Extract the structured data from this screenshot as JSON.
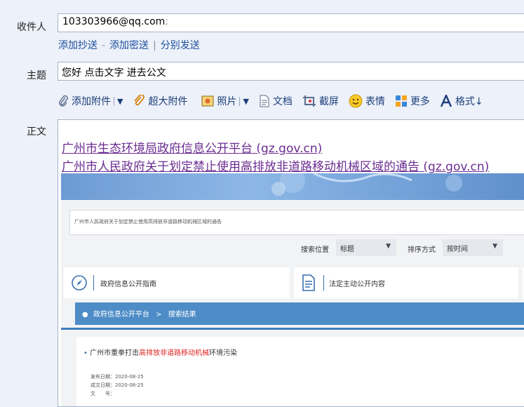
{
  "to": {
    "label": "收件人",
    "value": "103303966@qq.com",
    "suffix": ";"
  },
  "cc_links": {
    "cc": "添加抄送",
    "dash": "-",
    "bcc": "添加密送",
    "bar": "|",
    "separate": "分别发送"
  },
  "subject": {
    "label": "主题",
    "value": "您好 点击文字 进去公文"
  },
  "toolbar": {
    "attach": "添加附件",
    "big_attach": "超大附件",
    "photo": "照片",
    "doc": "文档",
    "screenshot": "截屏",
    "emoji": "表情",
    "more": "更多",
    "format": "格式↓"
  },
  "body": {
    "label": "正文",
    "link1": "广州市生态环境局政府信息公开平台 (gz.gov.cn)",
    "link2": "广州市人民政府关于划定禁止使用高排放非道路移动机械区域的通告 (gz.gov.cn)"
  },
  "screenshot": {
    "search_text": "广州市人民政府关于划定禁止使用高排放非道路移动机械区域的通告",
    "search_pos_label": "搜索位置",
    "search_pos_value": "标题",
    "sort_label": "排序方式",
    "sort_value": "按时间",
    "card1": "政府信息公开指南",
    "card2": "法定主动公开内容",
    "breadcrumb_home": "政府信息公开平台",
    "breadcrumb_sep": ">",
    "breadcrumb_current": "搜索结果",
    "result_title_pre": "广州市重拳打击",
    "result_title_hl": "高排放非道路移动机械",
    "result_title_post": "环境污染",
    "pub_date": "发布日期：2020-08-25",
    "doc_date": "成文日期：2020-08-25",
    "doc_no": "文　　号："
  }
}
